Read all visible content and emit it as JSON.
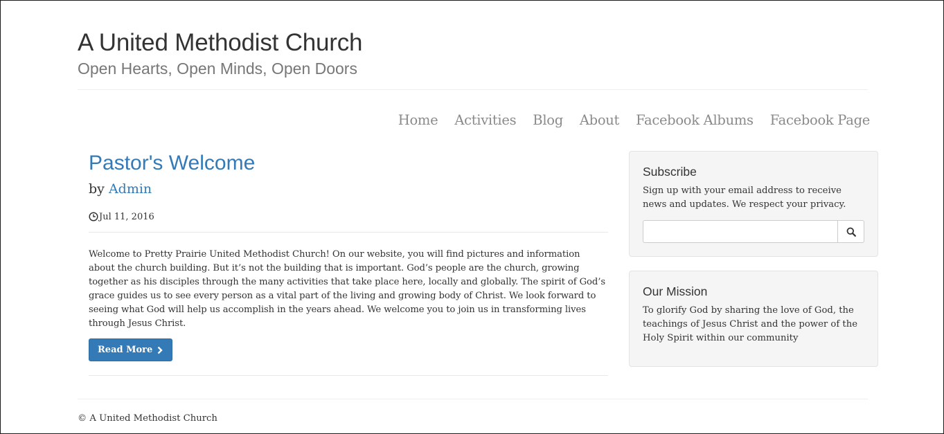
{
  "site": {
    "title": "A United Methodist Church",
    "tagline": "Open Hearts, Open Minds, Open Doors"
  },
  "nav": {
    "items": [
      "Home",
      "Activities",
      "Blog",
      "About",
      "Facebook Albums",
      "Facebook Page"
    ]
  },
  "post": {
    "title": "Pastor's Welcome",
    "by_label": "by",
    "author": "Admin",
    "date": "Jul 11, 2016",
    "date_icon": "clock-icon",
    "body": "Welcome to Pretty Prairie United Methodist Church! On our website, you will find pictures and information about the church building. But it’s not the building that is important. God’s people are the church, growing together as his disciples through the many activities that take place here, locally and globally. The spirit of God’s grace guides us to see every person as a vital part of the living and growing body of Christ. We look forward to seeing what God will help us accomplish in the years ahead. We welcome you to join us in transforming lives through Jesus Christ.",
    "read_more_label": "Read More",
    "read_more_icon": "chevron-right-icon"
  },
  "sidebar": {
    "subscribe": {
      "title": "Subscribe",
      "text": "Sign up with your email address to receive news and updates. We respect your privacy.",
      "input_value": "",
      "search_icon": "search-icon"
    },
    "mission": {
      "title": "Our Mission",
      "text": "To glorify God by sharing the love of God, the teachings of Jesus Christ and the power of the Holy Spirit within our community"
    }
  },
  "footer": {
    "copyright": "© A United Methodist Church"
  },
  "colors": {
    "link": "#337ab7",
    "nav_text": "#8a8a8a",
    "well_bg": "#f5f5f5"
  }
}
